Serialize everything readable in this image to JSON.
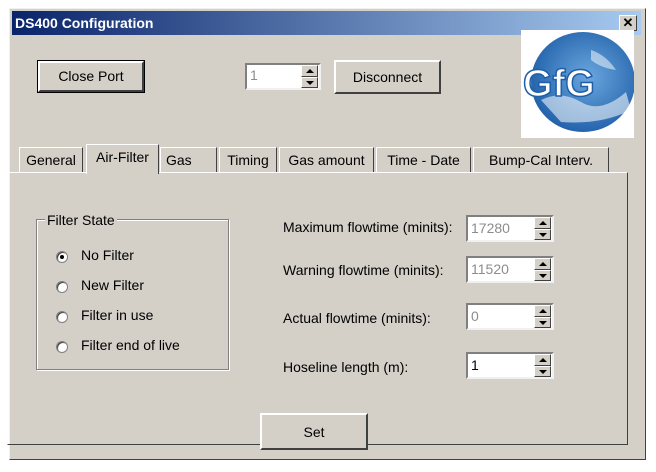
{
  "window": {
    "title": "DS400 Configuration",
    "close_glyph": "✕"
  },
  "toolbar": {
    "close_port_label": "Close Port",
    "port_value": "1",
    "disconnect_label": "Disconnect"
  },
  "logo": {
    "text": "GfG",
    "icon": "gfg-globe-logo"
  },
  "tabs": [
    {
      "label": "General",
      "active": false
    },
    {
      "label": "Air-Filter",
      "active": true
    },
    {
      "label": "Gas",
      "active": false
    },
    {
      "label": "Timing",
      "active": false
    },
    {
      "label": "Gas amount",
      "active": false
    },
    {
      "label": "Time - Date",
      "active": false
    },
    {
      "label": "Bump-Cal Interv.",
      "active": false
    }
  ],
  "filter_state": {
    "title": "Filter State",
    "options": [
      {
        "label": "No Filter",
        "selected": true
      },
      {
        "label": "New Filter",
        "selected": false
      },
      {
        "label": "Filter in use",
        "selected": false
      },
      {
        "label": "Filter end of live",
        "selected": false
      }
    ]
  },
  "fields": [
    {
      "label": "Maximum flowtime (minits):",
      "value": "17280",
      "readonly": true
    },
    {
      "label": "Warning flowtime (minits):",
      "value": "11520",
      "readonly": true
    },
    {
      "label": "Actual flowtime (minits):",
      "value": "0",
      "readonly": true
    },
    {
      "label": "Hoseline length (m):",
      "value": "1",
      "readonly": false
    }
  ],
  "set_label": "Set",
  "colors": {
    "face": "#d4d0c8",
    "title_start": "#0a246a",
    "title_end": "#a6caf0",
    "logo_blue": "#1f5fa8"
  }
}
